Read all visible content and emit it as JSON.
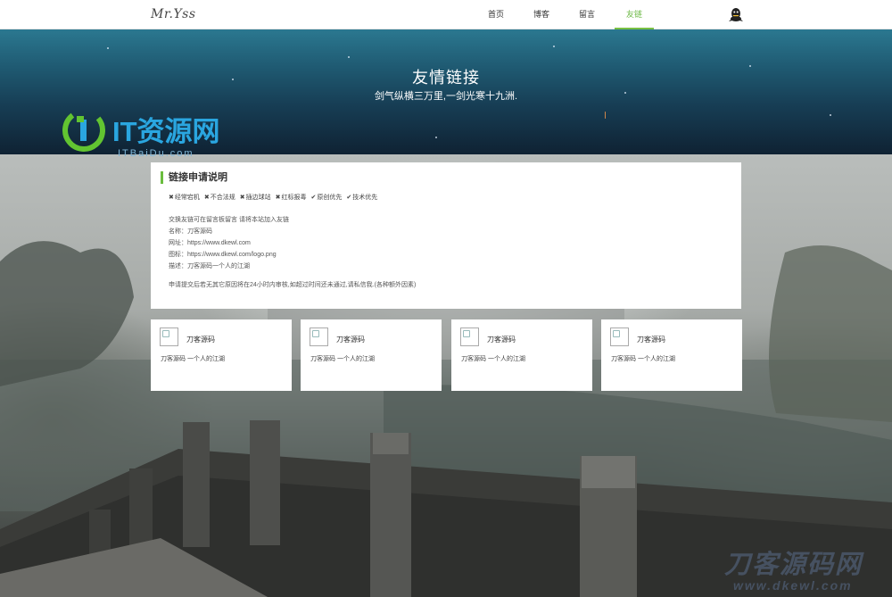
{
  "header": {
    "logo": "Mr.Yss",
    "nav": [
      {
        "label": "首页",
        "active": false
      },
      {
        "label": "博客",
        "active": false
      },
      {
        "label": "留言",
        "active": false
      },
      {
        "label": "友链",
        "active": true
      }
    ],
    "qq_icon": "qq-penguin-icon",
    "accent_color": "#7ac043"
  },
  "hero": {
    "title": "友情链接",
    "subtitle": "剑气纵横三万里,一剑光寒十九洲."
  },
  "watermark": {
    "top_logo": "IT资源网",
    "top_logo_sub": "ITBaiDu.com",
    "bottom_logo": "刀客源码网",
    "bottom_logo_sub": "www.dkewl.com"
  },
  "apply": {
    "heading": "链接申请说明",
    "tags": [
      {
        "mark": "✖",
        "text": "经常宕机"
      },
      {
        "mark": "✖",
        "text": "不合法规"
      },
      {
        "mark": "✖",
        "text": "插边球站"
      },
      {
        "mark": "✖",
        "text": "红标报毒"
      },
      {
        "mark": "✔",
        "text": "原创优先"
      },
      {
        "mark": "✔",
        "text": "技术优先"
      }
    ],
    "lines": [
      "交换友链可在留言板留言 请将本站加入友链",
      "名称：刀客源码",
      "网址：https://www.dkewl.com",
      "图标：https://www.dkewl.com/logo.png",
      "描述：刀客源码一个人的江湖"
    ],
    "notice": "申请提交后若无其它原因将在24小时内审核,如超过时间还未通过,请私信我.(各种额外因素)"
  },
  "links": [
    {
      "name": "刀客源码",
      "desc": "刀客源码 一个人的江湖"
    },
    {
      "name": "刀客源码",
      "desc": "刀客源码 一个人的江湖"
    },
    {
      "name": "刀客源码",
      "desc": "刀客源码 一个人的江湖"
    },
    {
      "name": "刀客源码",
      "desc": "刀客源码 一个人的江湖"
    }
  ]
}
